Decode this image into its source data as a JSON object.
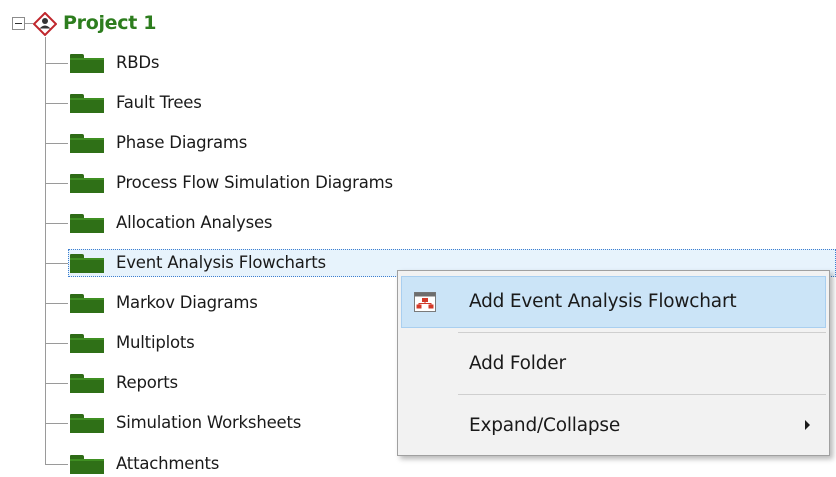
{
  "project": {
    "name": "Project 1",
    "icon": "project-diamond-icon"
  },
  "tree": {
    "items": [
      {
        "label": "RBDs"
      },
      {
        "label": "Fault Trees"
      },
      {
        "label": "Phase Diagrams"
      },
      {
        "label": "Process Flow Simulation Diagrams"
      },
      {
        "label": "Allocation Analyses"
      },
      {
        "label": "Event Analysis Flowcharts",
        "selected": true
      },
      {
        "label": "Markov Diagrams"
      },
      {
        "label": "Multiplots"
      },
      {
        "label": "Reports"
      },
      {
        "label": "Simulation Worksheets"
      },
      {
        "label": "Attachments"
      }
    ]
  },
  "context_menu": {
    "items": [
      {
        "label": "Add Event Analysis Flowchart",
        "icon": "flowchart-icon",
        "highlighted": true
      },
      {
        "label": "Add Folder"
      },
      {
        "label": "Expand/Collapse",
        "submenu": true
      }
    ]
  },
  "colors": {
    "project_label": "#2d7d1e",
    "folder": "#2f7017",
    "selection": "#e7f3fc",
    "menu_highlight": "#cbe4f7",
    "menu_background": "#f2f2f2"
  }
}
